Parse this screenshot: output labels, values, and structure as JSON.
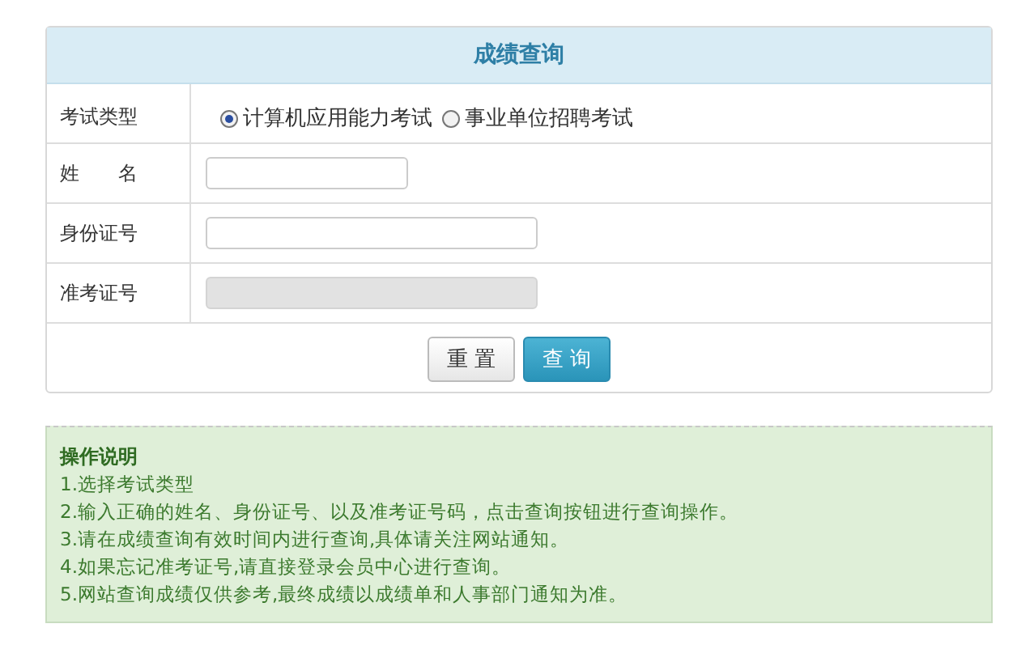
{
  "panel": {
    "title": "成绩查询"
  },
  "rows": [
    {
      "kind": "radio",
      "label": "考试类型",
      "options": [
        {
          "label": "计算机应用能力考试",
          "selected": true
        },
        {
          "label": "事业单位招聘考试",
          "selected": false
        }
      ]
    },
    {
      "kind": "short_field",
      "label": "姓　　名",
      "disabled": false
    },
    {
      "kind": "long_field",
      "label": "身份证号",
      "disabled": false
    },
    {
      "kind": "long_field",
      "label": "准考证号",
      "disabled": true
    }
  ],
  "buttons": [
    {
      "label": "重 置",
      "kind": "default"
    },
    {
      "label": "查 询",
      "kind": "primary"
    }
  ],
  "instructions": {
    "title": "操作说明",
    "items": [
      "1.选择考试类型",
      "2.输入正确的姓名、身份证号、以及准考证号码，点击查询按钮进行查询操作。",
      "3.请在成绩查询有效时间内进行查询,具体请关注网站通知。",
      "4.如果忘记准考证号,请直接登录会员中心进行查询。",
      "5.网站查询成绩仅供参考,最终成绩以成绩单和人事部门通知为准。"
    ]
  }
}
